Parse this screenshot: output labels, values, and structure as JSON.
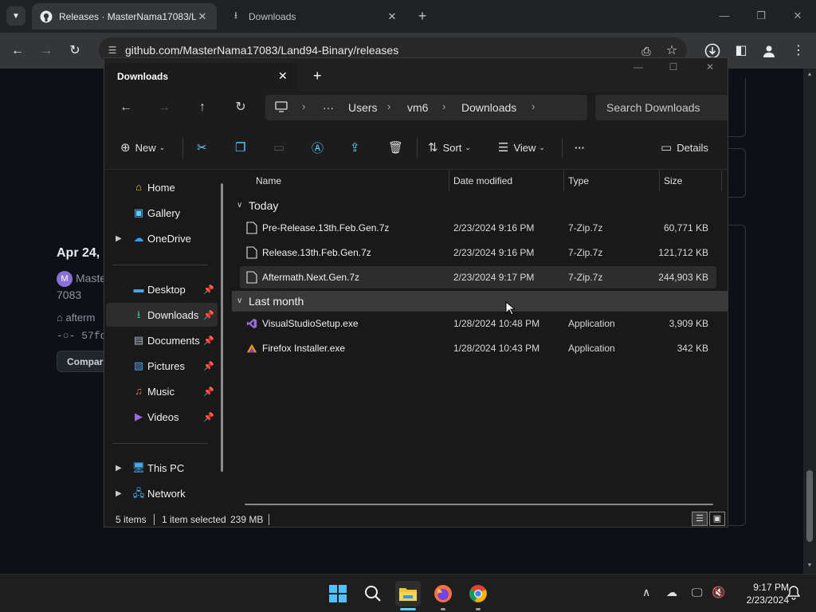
{
  "chrome": {
    "tabs": [
      {
        "title": "Releases · MasterNama17083/L",
        "close": "✕"
      },
      {
        "title": "Downloads",
        "close": "✕"
      }
    ],
    "new_tab": "+",
    "url": "github.com/MasterNama17083/Land94-Binary/releases"
  },
  "github_page": {
    "release_date": "Apr 24, 2",
    "avatar_letter": "M",
    "author_line1": "Maste",
    "author_line2": "7083",
    "tag": "afterm",
    "commit": "57fdc",
    "compare_button": "Compar"
  },
  "explorer": {
    "tab_title": "Downloads",
    "tab_close": "✕",
    "new_tab": "+",
    "breadcrumb": [
      "Users",
      "vm6",
      "Downloads"
    ],
    "breadcrumb_more": "···",
    "search_placeholder": "Search Downloads",
    "commands": {
      "new": "New",
      "sort": "Sort",
      "view": "View",
      "more": "···",
      "details": "Details"
    },
    "sidebar": {
      "quick": [
        {
          "label": "Home"
        },
        {
          "label": "Gallery"
        },
        {
          "label": "OneDrive"
        }
      ],
      "pinned": [
        {
          "label": "Desktop"
        },
        {
          "label": "Downloads"
        },
        {
          "label": "Documents"
        },
        {
          "label": "Pictures"
        },
        {
          "label": "Music"
        },
        {
          "label": "Videos"
        }
      ],
      "devices": [
        {
          "label": "This PC"
        },
        {
          "label": "Network"
        }
      ]
    },
    "columns": {
      "name": "Name",
      "date": "Date modified",
      "type": "Type",
      "size": "Size"
    },
    "groups": [
      {
        "label": "Today",
        "files": [
          {
            "name": "Pre-Release.13th.Feb.Gen.7z",
            "date": "2/23/2024 9:16 PM",
            "type": "7-Zip.7z",
            "size": "60,771 KB"
          },
          {
            "name": "Release.13th.Feb.Gen.7z",
            "date": "2/23/2024 9:16 PM",
            "type": "7-Zip.7z",
            "size": "121,712 KB"
          },
          {
            "name": "Aftermath.Next.Gen.7z",
            "date": "2/23/2024 9:17 PM",
            "type": "7-Zip.7z",
            "size": "244,903 KB"
          }
        ]
      },
      {
        "label": "Last month",
        "files": [
          {
            "name": "VisualStudioSetup.exe",
            "date": "1/28/2024 10:48 PM",
            "type": "Application",
            "size": "3,909 KB"
          },
          {
            "name": "Firefox Installer.exe",
            "date": "1/28/2024 10:43 PM",
            "type": "Application",
            "size": "342 KB"
          }
        ]
      }
    ],
    "status": {
      "items": "5 items",
      "selected": "1 item selected",
      "size": "239 MB"
    }
  },
  "taskbar": {
    "time": "9:17 PM",
    "date": "2/23/2024"
  },
  "colors": {
    "accent": "#60cdff",
    "folder": "#f3c33a",
    "selection": "#2d2d2d"
  }
}
